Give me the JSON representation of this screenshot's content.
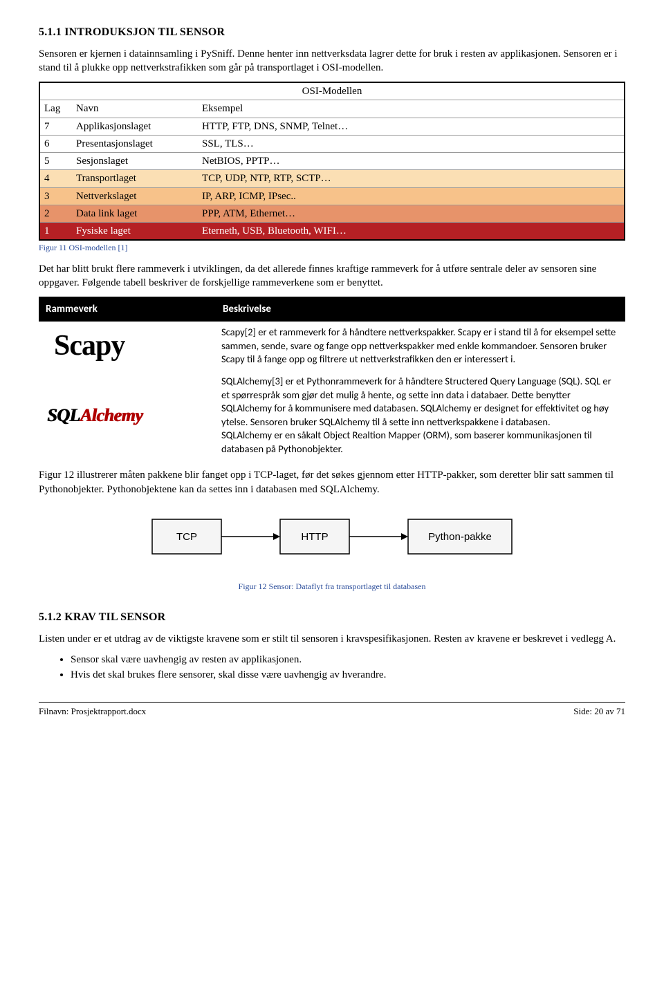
{
  "section1": {
    "number": "5.1.1",
    "title_prefix": "I",
    "title_rest": "NTRODUKSJON TIL ",
    "title_prefix2": "S",
    "title_rest2": "ENSOR",
    "para1": "Sensoren er kjernen i datainnsamling i PySniff. Denne henter inn nettverksdata lagrer dette for bruk i resten av applikasjonen. Sensoren er i stand til å plukke opp nettverkstrafikken som går på transportlaget i OSI-modellen."
  },
  "osi": {
    "title": "OSI-Modellen",
    "headers": {
      "c0": "Lag",
      "c1": "Navn",
      "c2": "Eksempel"
    },
    "rows": [
      {
        "num": "7",
        "name": "Applikasjonslaget",
        "ex": "HTTP, FTP, DNS, SNMP, Telnet…",
        "bg": "#ffffff"
      },
      {
        "num": "6",
        "name": "Presentasjonslaget",
        "ex": "SSL, TLS…",
        "bg": "#ffffff"
      },
      {
        "num": "5",
        "name": "Sesjonslaget",
        "ex": "NetBIOS, PPTP…",
        "bg": "#ffffff"
      },
      {
        "num": "4",
        "name": "Transportlaget",
        "ex": "TCP, UDP, NTP, RTP, SCTP…",
        "bg": "#fbdfb4"
      },
      {
        "num": "3",
        "name": "Nettverkslaget",
        "ex": "IP, ARP, ICMP, IPsec..",
        "bg": "#f7c28a"
      },
      {
        "num": "2",
        "name": "Data link laget",
        "ex": "PPP, ATM, Ethernet…",
        "bg": "#e7936a"
      },
      {
        "num": "1",
        "name": "Fysiske laget",
        "ex": "Eterneth, USB, Bluetooth, WIFI…",
        "bg": "#b52024"
      }
    ],
    "caption": "Figur 11 OSI-modellen [1]"
  },
  "paraAfterOsi": "Det har blitt brukt flere rammeverk i utviklingen, da det allerede finnes kraftige rammeverk for å utføre sentrale deler av sensoren sine oppgaver. Følgende tabell beskriver de forskjellige rammeverkene som er benyttet.",
  "frameworks": {
    "headers": {
      "c0": "Rammeverk",
      "c1": "Beskrivelse"
    },
    "rows": [
      {
        "logo": "Scapy",
        "desc": "Scapy[2] er et rammeverk for å håndtere nettverkspakker. Scapy er i stand til å for eksempel sette sammen, sende, svare og fange opp nettverkspakker med enkle kommandoer. Sensoren bruker Scapy til å fange opp og filtrere ut nettverkstrafikken den er interessert i."
      },
      {
        "logo": "SQLAlchemy",
        "desc": "SQLAlchemy[3] er et Pythonrammeverk for å håndtere Structered Query Language (SQL). SQL er et spørrespråk som gjør det mulig å hente, og sette inn data i databaer. Dette benytter SQLAlchemy for å kommunisere med databasen. SQLAlchemy er designet for effektivitet og høy ytelse. Sensoren bruker SQLAlchemy til å sette inn nettverkspakkene i databasen.\nSQLAlchemy er en såkalt Object Realtion Mapper (ORM), som baserer kommunikasjonen til databasen på Pythonobjekter."
      }
    ]
  },
  "paraAfterFrameworks": "Figur 12 illustrerer måten pakkene blir fanget opp i TCP-laget, før det søkes gjennom etter HTTP-pakker, som deretter blir satt sammen til Pythonobjekter. Pythonobjektene kan da settes inn i databasen med SQLAlchemy.",
  "diagram": {
    "boxes": [
      "TCP",
      "HTTP",
      "Python-pakke"
    ],
    "caption": "Figur 12 Sensor: Dataflyt fra transportlaget til databasen"
  },
  "section2": {
    "number": "5.1.2",
    "title_prefix": "K",
    "title_rest": "RAV TIL ",
    "title_prefix2": "S",
    "title_rest2": "ENSOR",
    "para": "Listen under er et utdrag av de viktigste kravene som er stilt til sensoren i kravspesifikasjonen. Resten av kravene er beskrevet i vedlegg A.",
    "bullets": [
      "Sensor skal være uavhengig av resten av applikasjonen.",
      "Hvis det skal brukes flere sensorer, skal disse være uavhengig av hverandre."
    ]
  },
  "footer": {
    "left": "Filnavn: Prosjektrapport.docx",
    "right": "Side: 20 av 71"
  },
  "chart_data": {
    "type": "table",
    "title": "OSI-Modellen",
    "columns": [
      "Lag",
      "Navn",
      "Eksempel"
    ],
    "rows": [
      [
        "7",
        "Applikasjonslaget",
        "HTTP, FTP, DNS, SNMP, Telnet…"
      ],
      [
        "6",
        "Presentasjonslaget",
        "SSL, TLS…"
      ],
      [
        "5",
        "Sesjonslaget",
        "NetBIOS, PPTP…"
      ],
      [
        "4",
        "Transportlaget",
        "TCP, UDP, NTP, RTP, SCTP…"
      ],
      [
        "3",
        "Nettverkslaget",
        "IP, ARP, ICMP, IPsec.."
      ],
      [
        "2",
        "Data link laget",
        "PPP, ATM, Ethernet…"
      ],
      [
        "1",
        "Fysiske laget",
        "Eterneth, USB, Bluetooth, WIFI…"
      ]
    ]
  }
}
